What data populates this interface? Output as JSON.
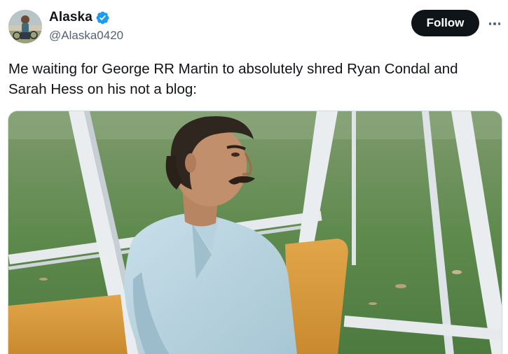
{
  "author": {
    "display_name": "Alaska",
    "handle": "@Alaska0420",
    "verified": true,
    "verified_icon": "verified-badge-icon",
    "verified_color": "#1d9bf0"
  },
  "actions": {
    "follow_label": "Follow",
    "more_icon": "more-horizontal-icon"
  },
  "tweet": {
    "text": "Me waiting for George RR Martin to absolutely shred Ryan Condal and Sarah Hess on his not a blog:"
  },
  "colors": {
    "follow_bg": "#0f1419",
    "text_primary": "#0f1419",
    "text_secondary": "#536471"
  }
}
